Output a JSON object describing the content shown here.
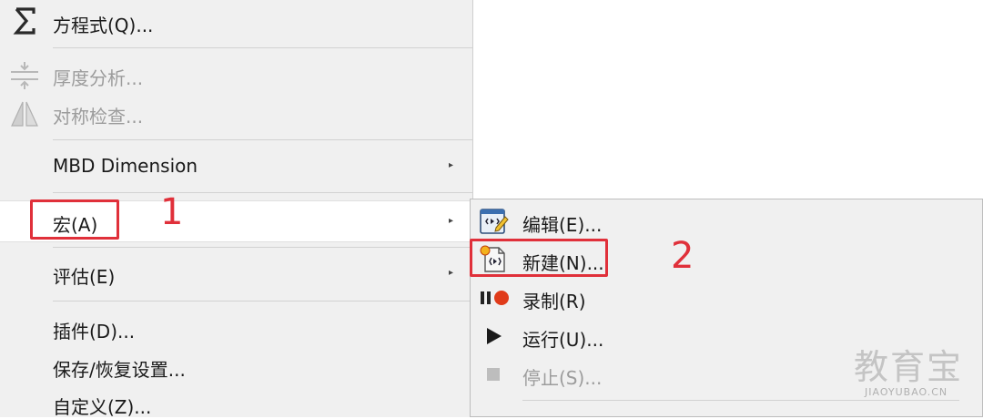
{
  "main_menu": {
    "items": [
      {
        "label": "方程式(Q)...",
        "icon": "sigma-icon",
        "enabled": true
      },
      {
        "label": "厚度分析...",
        "icon": "thickness-icon",
        "enabled": false
      },
      {
        "label": "对称检查...",
        "icon": "symmetry-icon",
        "enabled": false
      },
      {
        "label": "MBD Dimension",
        "submenu": true,
        "enabled": true
      },
      {
        "label": "宏(A)",
        "submenu": true,
        "enabled": true,
        "highlighted": true
      },
      {
        "label": "评估(E)",
        "submenu": true,
        "enabled": true
      },
      {
        "label": "插件(D)...",
        "enabled": true
      },
      {
        "label": "保存/恢复设置...",
        "enabled": true
      },
      {
        "label": "自定义(Z)...",
        "enabled": true
      }
    ],
    "submenu_arrow": "▸"
  },
  "macro_submenu": {
    "items": [
      {
        "label": "编辑(E)...",
        "icon": "macro-edit-icon",
        "enabled": true
      },
      {
        "label": "新建(N)...",
        "icon": "macro-new-icon",
        "enabled": true
      },
      {
        "label": "录制(R)",
        "icon": "record-icon",
        "enabled": true
      },
      {
        "label": "运行(U)...",
        "icon": "play-icon",
        "enabled": true
      },
      {
        "label": "停止(S)...",
        "icon": "stop-icon",
        "enabled": false
      }
    ]
  },
  "annotations": {
    "step1": "1",
    "step2": "2",
    "color": "#e0303a"
  },
  "watermark": {
    "main": "教育宝",
    "sub": "JIAOYUBAO.CN"
  }
}
